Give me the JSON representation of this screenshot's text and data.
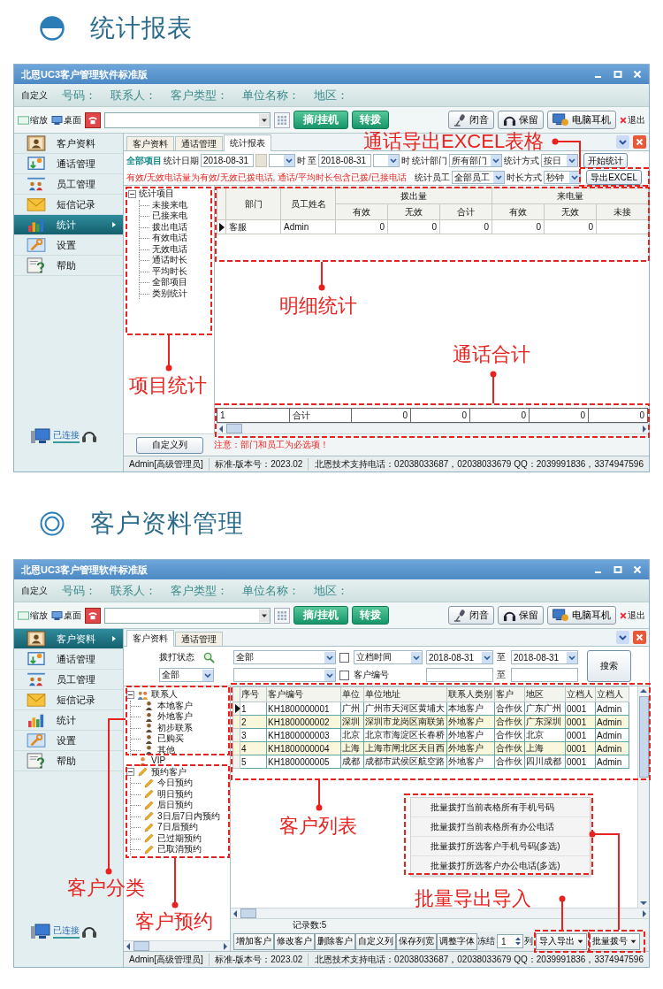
{
  "sections": [
    {
      "kind": "stats",
      "heading": {
        "kind": "half",
        "title": "统计报表"
      },
      "window": {
        "title": "北恩UC3客户管理软件标准版",
        "info_bar": {
          "custom": "自定义",
          "fields": [
            "号码：",
            "联系人：",
            "客户类型：",
            "单位名称：",
            "地区："
          ]
        },
        "toolbar": {
          "zoom": "缩放",
          "desktop": "桌面",
          "dial": "摘/挂机",
          "transfer": "转拨",
          "mute": "闭音",
          "hold": "保留",
          "pc_headset": "电脑耳机",
          "exit": "退出"
        },
        "sidebar": [
          {
            "kind": "contacts",
            "label": "客户资料",
            "selected": false
          },
          {
            "kind": "calls",
            "label": "通话管理",
            "selected": false
          },
          {
            "kind": "staff",
            "label": "员工管理",
            "selected": false
          },
          {
            "kind": "sms",
            "label": "短信记录",
            "selected": false
          },
          {
            "kind": "stats",
            "label": "统计",
            "selected": true
          },
          {
            "kind": "settings",
            "label": "设置",
            "selected": false
          },
          {
            "kind": "help",
            "label": "帮助",
            "selected": false
          }
        ],
        "connection": "已连接",
        "status_bar": [
          "Admin[高级管理员]",
          "标准-版本号：2023.02",
          "北恩技术支持电话：02038033687，02038033679 QQ：2039991836，3374947596"
        ]
      },
      "tabs": [
        {
          "label": "客户资料",
          "selected": false
        },
        {
          "label": "通话管理",
          "selected": false
        },
        {
          "label": "统计报表",
          "selected": true
        }
      ],
      "filters": {
        "scope": "全部项目",
        "date_label": "统计日期",
        "date_from": "2018-08-31",
        "hour_unit_1": "时",
        "to": "至",
        "date_to": "2018-08-31",
        "hour_unit_2": "时",
        "dept_label": "统计部门",
        "dept": "所有部门",
        "method_label": "统计方式",
        "method": "按日",
        "start_button": "开始统计",
        "note": "有效/无效电话量为有效/无效已拨电话, 通话/平均时长包含已拨/已接电话",
        "staff_label": "统计员工",
        "staff": "全部员工",
        "duration_label": "时长方式",
        "duration": "秒钟",
        "export_button": "导出EXCEL"
      },
      "tree": {
        "label": "统计项目",
        "expanded": true,
        "children": [
          {
            "label": "未接来电"
          },
          {
            "label": "已接来电"
          },
          {
            "label": "拨出电话"
          },
          {
            "label": "有效电话"
          },
          {
            "label": "无效电话"
          },
          {
            "label": "通话时长"
          },
          {
            "label": "平均时长"
          },
          {
            "label": "全部项目"
          },
          {
            "label": "类别统计"
          }
        ]
      },
      "table": {
        "columns": [
          {
            "label": "部门"
          },
          {
            "label": "员工姓名"
          },
          {
            "label": "拨出量",
            "colspan": 3,
            "children": [
              "有效",
              "无效",
              "合计"
            ]
          },
          {
            "label": "来电量",
            "colspan": 3,
            "children": [
              "有效",
              "无效",
              "未接"
            ]
          }
        ],
        "rows": [
          {
            "selected": true,
            "cells": [
              "客服",
              "Admin",
              "0",
              "0",
              "0",
              "0",
              "0"
            ]
          }
        ],
        "total": [
          "1",
          "合计",
          "0",
          "0",
          "0",
          "0",
          "0"
        ]
      },
      "footer": {
        "button": "自定义列",
        "note": "注意：部门和员工为必选项！"
      },
      "annotations": [
        {
          "label": "通话导出EXCEL表格"
        },
        {
          "label": "明细统计"
        },
        {
          "label": "通话合计"
        },
        {
          "label": "项目统计"
        }
      ]
    },
    {
      "kind": "customers",
      "heading": {
        "kind": "ring",
        "title": "客户资料管理"
      },
      "window": {
        "title": "北恩UC3客户管理软件标准版",
        "info_bar": {
          "custom": "自定义",
          "fields": [
            "号码：",
            "联系人：",
            "客户类型：",
            "单位名称：",
            "地区："
          ]
        },
        "toolbar": {
          "zoom": "缩放",
          "desktop": "桌面",
          "dial": "摘/挂机",
          "transfer": "转拨",
          "mute": "闭音",
          "hold": "保留",
          "pc_headset": "电脑耳机",
          "exit": "退出"
        },
        "sidebar": [
          {
            "kind": "contacts",
            "label": "客户资料",
            "selected": true
          },
          {
            "kind": "calls",
            "label": "通话管理",
            "selected": false
          },
          {
            "kind": "staff",
            "label": "员工管理",
            "selected": false
          },
          {
            "kind": "sms",
            "label": "短信记录",
            "selected": false
          },
          {
            "kind": "stats",
            "label": "统计",
            "selected": false
          },
          {
            "kind": "settings",
            "label": "设置",
            "selected": false
          },
          {
            "kind": "help",
            "label": "帮助",
            "selected": false
          }
        ],
        "connection": "已连接",
        "status_bar": [
          "Admin[高级管理员]",
          "标准-版本号：2023.02",
          "北恩技术支持电话：02038033687，02038033679 QQ：2039991836，3374947596"
        ]
      },
      "tabs": [
        {
          "label": "客户资料",
          "selected": true
        },
        {
          "label": "通话管理",
          "selected": false
        }
      ],
      "filters": {
        "status_label": "拨打状态",
        "status": "全部",
        "group": "全部",
        "date_field": {
          "checked": false,
          "value": "立档时间"
        },
        "date_from": "2018-08-31",
        "to_1": "至",
        "date_to": "2018-08-31",
        "number_field": {
          "checked": false,
          "label": "客户编号"
        },
        "to_2": "至",
        "search_button": "搜索"
      },
      "tree": [
        {
          "kind": "contacts",
          "label": "联系人",
          "expanded": true,
          "children": [
            {
              "label": "本地客户"
            },
            {
              "label": "外地客户"
            },
            {
              "label": "初步联系"
            },
            {
              "label": "已购买"
            },
            {
              "label": "其他"
            }
          ]
        },
        {
          "kind": "vip",
          "label": "VIP"
        },
        {
          "kind": "reservations",
          "label": "预约客户",
          "expanded": true,
          "children": [
            {
              "label": "今日预约"
            },
            {
              "label": "明日预约"
            },
            {
              "label": "后日预约"
            },
            {
              "label": "3日后7日内预约"
            },
            {
              "label": "7日后预约"
            },
            {
              "label": "已过期预约"
            },
            {
              "label": "已取消预约"
            }
          ]
        }
      ],
      "table": {
        "columns": [
          "序号",
          "客户编号",
          "单位",
          "单位地址",
          "联系人类别",
          "客户",
          "地区",
          "立档人",
          "立档人"
        ],
        "rows": [
          {
            "selected": true,
            "cells": [
              "1",
              "KH1800000001",
              "广州",
              "广州市天河区黄埔大",
              "本地客户",
              "合作伙",
              "广东广州",
              "0001",
              "Admin"
            ]
          },
          {
            "selected": false,
            "cells": [
              "2",
              "KH1800000002",
              "深圳",
              "深圳市龙岗区南联第",
              "外地客户",
              "合作伙",
              "广东深圳",
              "0001",
              "Admin"
            ]
          },
          {
            "selected": false,
            "cells": [
              "3",
              "KH1800000003",
              "北京",
              "北京市海淀区长春桥",
              "外地客户",
              "合作伙",
              "北京",
              "0001",
              "Admin"
            ]
          },
          {
            "selected": false,
            "cells": [
              "4",
              "KH1800000004",
              "上海",
              "上海市闸北区天目西",
              "外地客户",
              "合作伙",
              "上海",
              "0001",
              "Admin"
            ]
          },
          {
            "selected": false,
            "cells": [
              "5",
              "KH1800000005",
              "成都",
              "成都市武侯区航空路",
              "外地客户",
              "合作伙",
              "四川成都",
              "0001",
              "Admin"
            ]
          }
        ]
      },
      "menu": [
        "批量拨打当前表格所有手机号码",
        "批量拨打当前表格所有办公电话",
        "批量拨打所选客户手机号码(多选)",
        "批量拨打所选客户办公电话(多选)"
      ],
      "records": "记录数:5",
      "buttons": [
        "增加客户",
        "修改客户",
        "删除客户",
        "自定义列",
        "保存列宽",
        "调整字体"
      ],
      "freeze": {
        "label": "冻结",
        "value": "1",
        "unit": "列"
      },
      "dropdown_buttons": [
        "导入导出",
        "批量拨号"
      ],
      "annotations": [
        {
          "label": "客户列表"
        },
        {
          "label": "客户分类"
        },
        {
          "label": "批量导出导入"
        },
        {
          "label": "客户预约"
        }
      ]
    }
  ]
}
